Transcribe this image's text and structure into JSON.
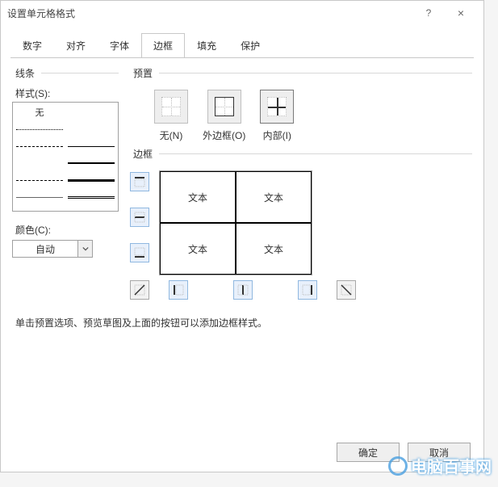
{
  "window": {
    "title": "设置单元格格式",
    "help": "?",
    "close": "×"
  },
  "tabs": [
    "数字",
    "对齐",
    "字体",
    "边框",
    "填充",
    "保护"
  ],
  "activeTabIndex": 3,
  "line": {
    "legend": "线条",
    "styleLabel": "样式(S):",
    "noneLabel": "无",
    "colorLabel": "颜色(C):",
    "colorValue": "自动"
  },
  "preset": {
    "legend": "预置",
    "items": [
      {
        "label": "无(N)"
      },
      {
        "label": "外边框(O)"
      },
      {
        "label": "内部(I)"
      }
    ]
  },
  "border": {
    "legend": "边框",
    "cellText": "文本"
  },
  "hint": "单击预置选项、预览草图及上面的按钮可以添加边框样式。",
  "footer": {
    "ok": "确定",
    "cancel": "取消"
  },
  "watermark": "电脑百事网"
}
